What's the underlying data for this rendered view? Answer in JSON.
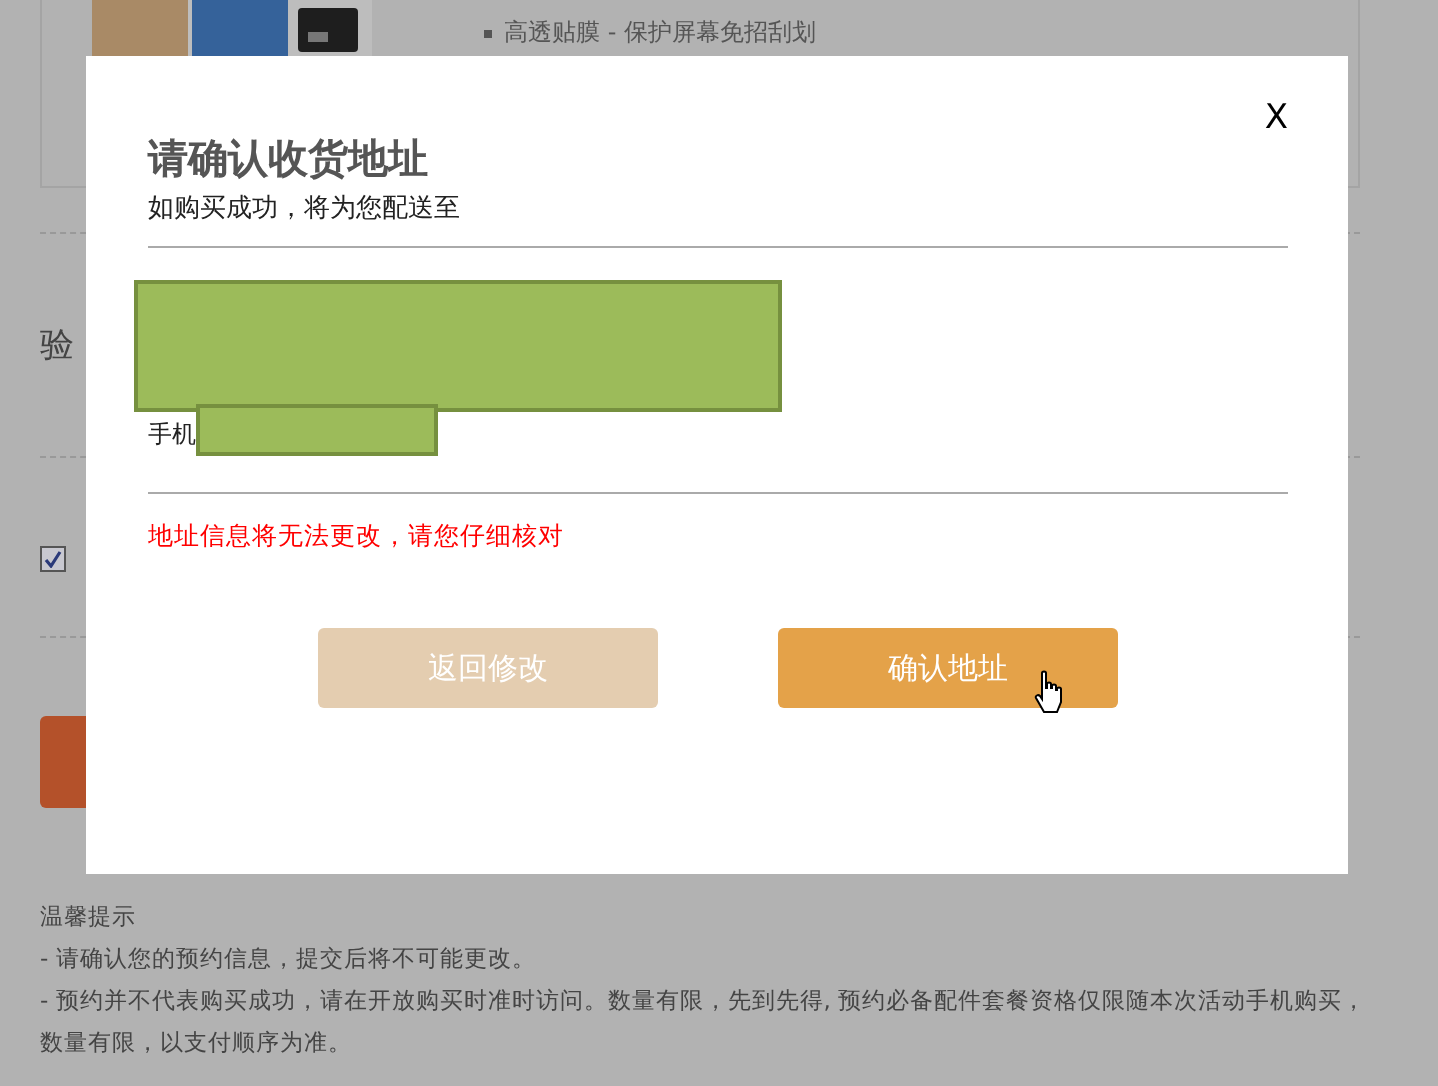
{
  "background": {
    "product": {
      "bullet": "高透贴膜 - 保护屏幕免招刮划"
    },
    "section_label": "验",
    "agree": {
      "checked": true
    },
    "tips": {
      "title": "温馨提示",
      "lines": [
        "- 请确认您的预约信息，提交后将不可能更改。",
        "- 预约并不代表购买成功，请在开放购买时准时访问。数量有限，先到先得, 预约必备配件套餐资格仅限随本次活动手机购买，数量有限，以支付顺序为准。"
      ]
    }
  },
  "dialog": {
    "close": "X",
    "title": "请确认收货地址",
    "subtitle": "如购买成功，将为您配送至",
    "phone_label": "手机",
    "warning": "地址信息将无法更改，请您仔细核对",
    "buttons": [
      {
        "label": "返回修改",
        "kind": "secondary"
      },
      {
        "label": "确认地址",
        "kind": "primary"
      }
    ]
  }
}
